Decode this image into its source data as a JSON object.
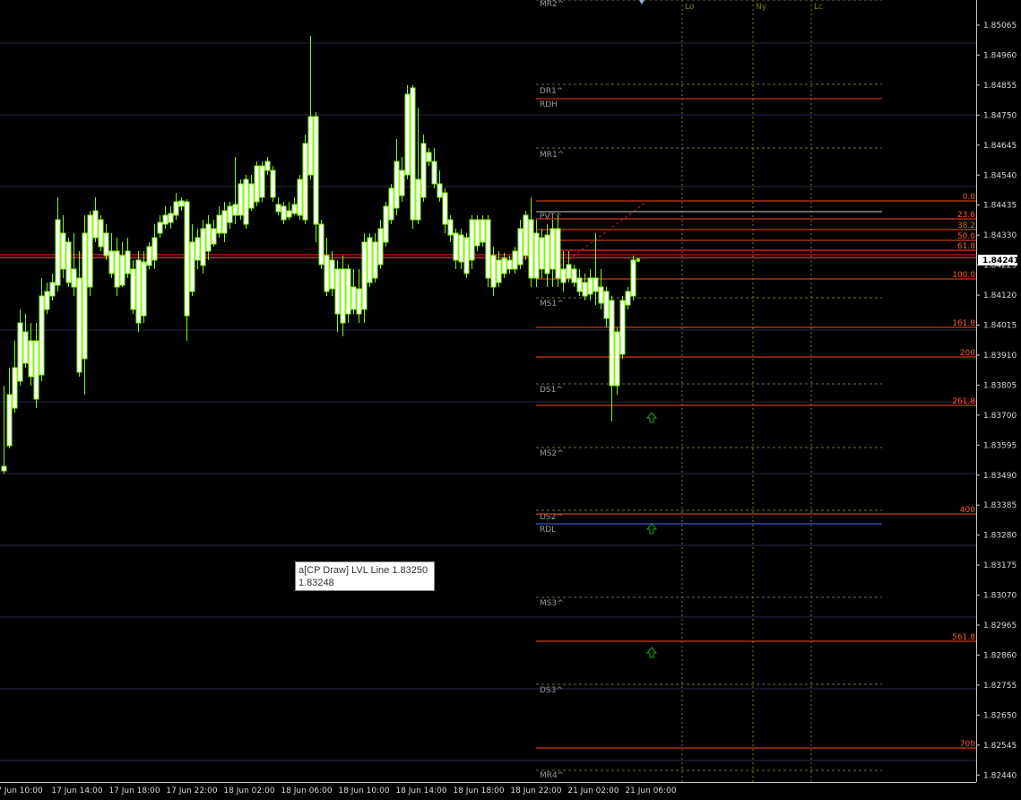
{
  "colors": {
    "background": "#000000",
    "candle": "#7CFC00",
    "candle_body_up": "#ffffff",
    "pivot_label": "#9a9a9a",
    "pivot_line": "#6e6e3a",
    "fib_line": "#ff4a1a",
    "fib_label": "#ff5a2a",
    "session": "#7a7a20",
    "hline": "#2a2a6a",
    "current_price_bg": "#ffffff",
    "red_line": "#ff2222"
  },
  "price_axis": {
    "ticks": [
      "1.85065",
      "1.84960",
      "1.84855",
      "1.84750",
      "1.84645",
      "1.84540",
      "1.84435",
      "1.84330",
      "1.84225",
      "1.84120",
      "1.84015",
      "1.83910",
      "1.83805",
      "1.83700",
      "1.83595",
      "1.83490",
      "1.83385",
      "1.83280",
      "1.83175",
      "1.83070",
      "1.82965",
      "1.82860",
      "1.82755",
      "1.82650",
      "1.82545",
      "1.82440"
    ],
    "current_price": "1.84241"
  },
  "time_axis": {
    "labels": [
      "7 Jun 10:00",
      "17 Jun 14:00",
      "17 Jun 18:00",
      "17 Jun 22:00",
      "18 Jun 02:00",
      "18 Jun 06:00",
      "18 Jun 10:00",
      "18 Jun 14:00",
      "18 Jun 18:00",
      "18 Jun 22:00",
      "21 Jun 02:00",
      "21 Jun 06:00"
    ]
  },
  "sessions": [
    "Lo",
    "Ny",
    "Lc"
  ],
  "pivots": [
    "MR2^",
    "DR1^",
    "RDH",
    "MR1^",
    "PVT^",
    "MS1^",
    "DS1^",
    "MS2^",
    "DS2^",
    "RDL",
    "MS3^",
    "DS3^",
    "MR4^"
  ],
  "fib_levels": [
    "0.0",
    "23.6",
    "38.2",
    "50.0",
    "61.8",
    "100.0",
    "161.8",
    "200",
    "261.8",
    "400",
    "561.8",
    "700"
  ],
  "tooltip": {
    "line1": "a[CP Draw] LVL Line 1.83250",
    "line2": "1.83248"
  }
}
